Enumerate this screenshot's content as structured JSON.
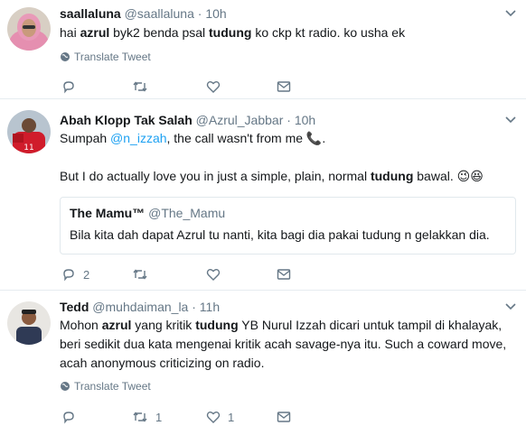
{
  "tweets": [
    {
      "name": "saallaluna",
      "handle": "@saallaluna",
      "dot": "·",
      "time": "10h",
      "text": [
        {
          "t": "hai "
        },
        {
          "t": "azrul",
          "bold": true
        },
        {
          "t": " byk2 benda psal "
        },
        {
          "t": "tudung",
          "bold": true
        },
        {
          "t": " ko ckp kt radio. ko usha ek"
        }
      ],
      "translate_label": "Translate Tweet",
      "reply_count": "",
      "retweet_count": "",
      "like_count": ""
    },
    {
      "name": "Abah Klopp Tak Salah",
      "handle": "@Azrul_Jabbar",
      "dot": "·",
      "time": "10h",
      "line1": [
        {
          "t": "Sumpah "
        },
        {
          "t": "@n_izzah",
          "mention": true
        },
        {
          "t": ", the call wasn't from me "
        }
      ],
      "phone_emoji": "📞",
      "line1_end": ".",
      "line2": [
        {
          "t": "But I do actually love you in just a simple, plain, normal "
        },
        {
          "t": "tudung",
          "bold": true
        },
        {
          "t": " bawal. "
        }
      ],
      "line2_emoji": "😉😆",
      "quote": {
        "name": "The Mamu™",
        "handle": "@The_Mamu",
        "text": "Bila kita dah dapat Azrul tu nanti, kita bagi dia pakai tudung n gelakkan dia."
      },
      "reply_count": "2",
      "retweet_count": "",
      "like_count": ""
    },
    {
      "name": "Tedd",
      "handle": "@muhdaiman_la",
      "dot": "·",
      "time": "11h",
      "lines": [
        [
          {
            "t": "Mohon "
          },
          {
            "t": "azrul",
            "bold": true
          },
          {
            "t": " yang kritik "
          },
          {
            "t": "tudung",
            "bold": true
          },
          {
            "t": " YB Nurul Izzah dicari untuk tampil di khalayak,"
          }
        ],
        [
          {
            "t": "beri sedikit dua kata mengenai kritik acah savage-nya itu. Such a coward move,"
          }
        ],
        [
          {
            "t": "acah anonymous  criticizing on radio."
          }
        ]
      ],
      "translate_label": "Translate Tweet",
      "reply_count": "",
      "retweet_count": "1",
      "like_count": "1"
    }
  ],
  "colors": {
    "text": "#14171a",
    "muted": "#657786",
    "link": "#1da1f2",
    "border": "#e6ecf0"
  },
  "icons": [
    "globe-icon",
    "reply-icon",
    "retweet-icon",
    "like-icon",
    "message-icon",
    "caret-down-icon"
  ]
}
